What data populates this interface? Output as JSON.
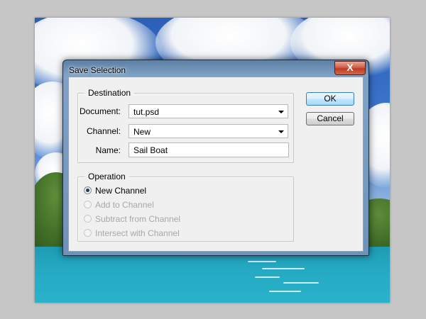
{
  "dialog": {
    "title": "Save Selection",
    "close_glyph": "X"
  },
  "destination": {
    "legend": "Destination",
    "document_label": "Document:",
    "document_value": "tut.psd",
    "channel_label": "Channel:",
    "channel_value": "New",
    "name_label": "Name:",
    "name_value": "Sail Boat"
  },
  "operation": {
    "legend": "Operation",
    "options": [
      {
        "label": "New Channel",
        "checked": true,
        "enabled": true
      },
      {
        "label": "Add to Channel",
        "checked": false,
        "enabled": false
      },
      {
        "label": "Subtract from Channel",
        "checked": false,
        "enabled": false
      },
      {
        "label": "Intersect with Channel",
        "checked": false,
        "enabled": false
      }
    ]
  },
  "buttons": {
    "ok": "OK",
    "cancel": "Cancel"
  },
  "colors": {
    "default_button": "#bee6fd",
    "window_frame": "#6f93b8",
    "close_button": "#c0391f"
  }
}
